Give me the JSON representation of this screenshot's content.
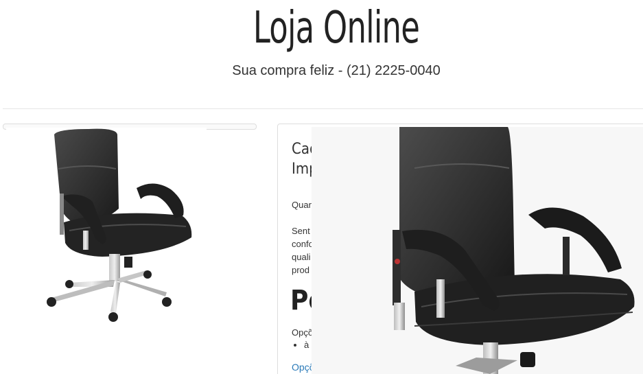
{
  "header": {
    "title": "Loja Online",
    "subtitle": "Sua compra feliz - (21) 2225-0040"
  },
  "product": {
    "title_lines": [
      "Cade",
      "Impe"
    ],
    "quantity_label": "Quar",
    "description_lines": [
      "Sent",
      "confo",
      "quali",
      "prod"
    ],
    "price_heading": "Po",
    "options_label": "Opçõ",
    "options_item": "à",
    "options_link": "Opçõ"
  },
  "icons": {
    "thumbnail": "office-chair-image",
    "zoom": "office-chair-zoom-image"
  }
}
